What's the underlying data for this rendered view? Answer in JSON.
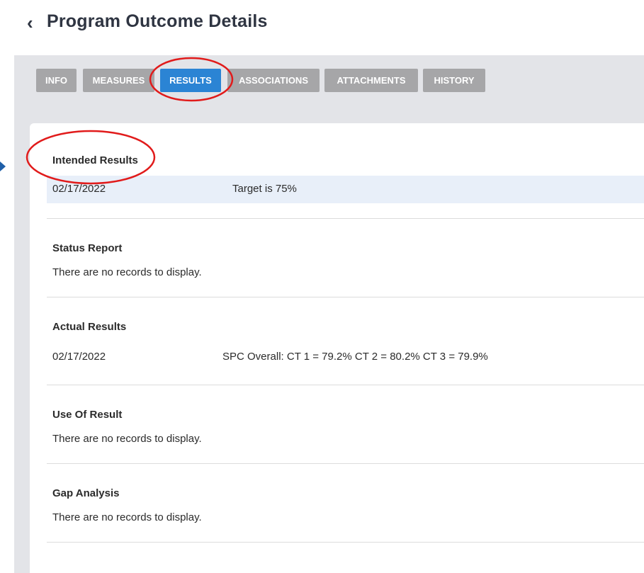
{
  "header": {
    "back_icon": "chevron-left-icon",
    "title": "Program Outcome Details"
  },
  "tabs": [
    {
      "label": "INFO",
      "active": false
    },
    {
      "label": "MEASURES",
      "active": false
    },
    {
      "label": "RESULTS",
      "active": true
    },
    {
      "label": "ASSOCIATIONS",
      "active": false
    },
    {
      "label": "ATTACHMENTS",
      "active": false
    },
    {
      "label": "HISTORY",
      "active": false
    }
  ],
  "sections": {
    "intended": {
      "title": "Intended Results",
      "date": "02/17/2022",
      "text": "Target is 75%"
    },
    "status": {
      "title": "Status Report",
      "empty": "There are no records to display."
    },
    "actual": {
      "title": "Actual Results",
      "date": "02/17/2022",
      "text": "SPC Overall: CT 1 = 79.2% CT 2 = 80.2% CT 3 = 79.9%"
    },
    "use": {
      "title": "Use Of Result",
      "empty": "There are no records to display."
    },
    "gap": {
      "title": "Gap Analysis",
      "empty": "There are no records to display."
    }
  },
  "colors": {
    "accent": "#2b84d4",
    "tab_inactive": "#a6a6a8",
    "annotation": "#e11b1b",
    "arrow": "#1f5fa8"
  }
}
